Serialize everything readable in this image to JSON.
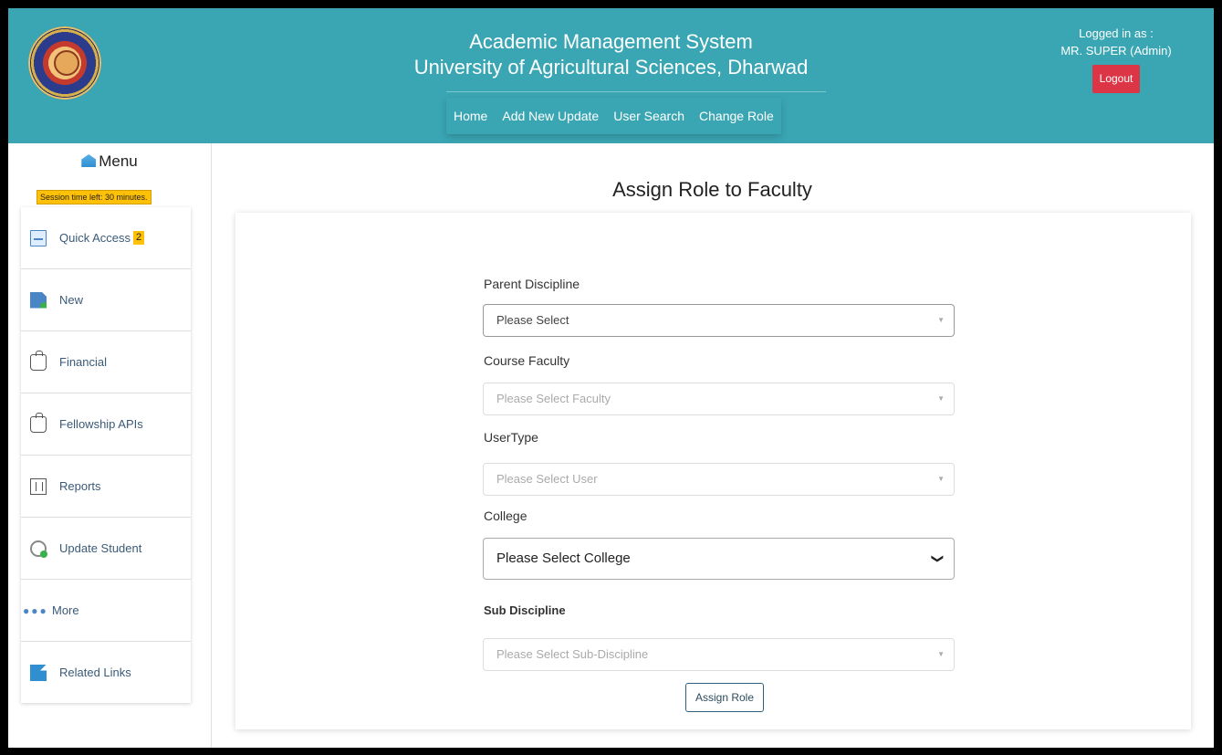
{
  "header": {
    "title_line1": "Academic Management System",
    "title_line2": "University of Agricultural Sciences, Dharwad",
    "nav": [
      "Home",
      "Add New Update",
      "User Search",
      "Change Role"
    ],
    "logged_in_label": "Logged in as :",
    "user": "MR. SUPER (Admin)",
    "logout_label": "Logout",
    "color": "#3aa6b3"
  },
  "sidebar": {
    "title": "Menu",
    "session": "Session time left: 30 minutes.",
    "items": [
      {
        "label": "Quick Access",
        "badge": "2",
        "icon": "quick-access-icon"
      },
      {
        "label": "New",
        "icon": "new-document-icon"
      },
      {
        "label": "Financial",
        "icon": "money-bag-icon"
      },
      {
        "label": "Fellowship APIs",
        "icon": "money-bag-icon"
      },
      {
        "label": "Reports",
        "icon": "report-icon"
      },
      {
        "label": "Update Student",
        "icon": "update-icon"
      },
      {
        "label": "More",
        "icon": "more-dots-icon"
      },
      {
        "label": "Related Links",
        "icon": "external-link-icon"
      }
    ]
  },
  "form": {
    "title": "Assign Role to Faculty",
    "fields": [
      {
        "label": "Parent Discipline",
        "value": "Please Select"
      },
      {
        "label": "Course Faculty",
        "value": "Please Select Faculty"
      },
      {
        "label": "UserType",
        "value": "Please Select User"
      },
      {
        "label": "College",
        "value": "Please Select College"
      },
      {
        "label": "Sub Discipline",
        "value": "Please Select Sub-Discipline"
      }
    ],
    "submit_label": "Assign Role",
    "logout_color": "#dc3545",
    "badge_color": "#ffc107"
  }
}
